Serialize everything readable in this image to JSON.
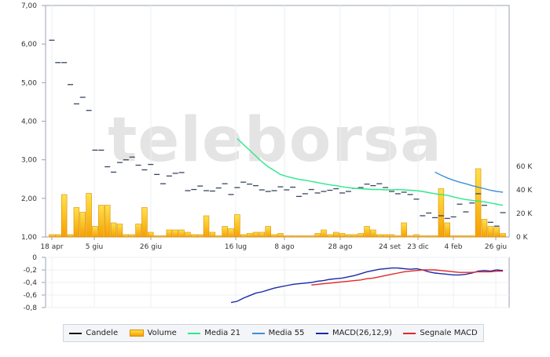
{
  "chart_data": [
    {
      "type": "candlestick",
      "panel": "price",
      "watermark": "teleborsa",
      "x_tick_labels": [
        "18 apr",
        "5 giu",
        "26 giu",
        "16 lug",
        "8 ago",
        "28 ago",
        "24 set",
        "23 dic",
        "4 feb",
        "26 giu"
      ],
      "y_left": {
        "ylim": [
          1.0,
          7.0
        ],
        "ticks": [
          "1,00",
          "2,00",
          "3,00",
          "4,00",
          "5,00",
          "6,00",
          "7,00"
        ]
      },
      "y_right": {
        "ylim": [
          0,
          60000
        ],
        "ticks": [
          "0 K",
          "20 K",
          "40 K",
          "60 K"
        ]
      },
      "grid": true,
      "series": [
        {
          "name": "Candele",
          "values": [
            6.1,
            5.52,
            5.52,
            4.95,
            4.45,
            4.62,
            4.28,
            3.25,
            3.25,
            2.82,
            2.68,
            2.93,
            3.0,
            3.07,
            2.86,
            2.74,
            2.88,
            2.62,
            2.38,
            2.58,
            2.65,
            2.67,
            2.2,
            2.23,
            2.32,
            2.2,
            2.19,
            2.27,
            2.38,
            2.1,
            2.28,
            2.42,
            2.37,
            2.33,
            2.22,
            2.18,
            2.2,
            2.3,
            2.22,
            2.29,
            2.05,
            2.12,
            2.23,
            2.14,
            2.18,
            2.21,
            2.25,
            2.14,
            2.18,
            2.26,
            2.28,
            2.37,
            2.33,
            2.38,
            2.28,
            2.18,
            2.12,
            2.16,
            2.1,
            1.98,
            1.55,
            1.62,
            1.5,
            1.55,
            1.48,
            1.52,
            1.85,
            1.65,
            1.88,
            2.12,
            1.82,
            1.38,
            1.28,
            1.63
          ]
        },
        {
          "name": "Volume",
          "values": [
            2000,
            2000,
            36000,
            2000,
            25000,
            21000,
            37000,
            9000,
            27000,
            27000,
            12000,
            11000,
            2000,
            2000,
            11000,
            25000,
            4000,
            1000,
            1000,
            6000,
            6000,
            6000,
            4000,
            2000,
            2000,
            18000,
            4000,
            1000,
            9000,
            7000,
            19000,
            2000,
            3000,
            4000,
            4000,
            9000,
            2000,
            3000,
            1000,
            1000,
            1000,
            1000,
            1000,
            3000,
            6000,
            2000,
            4000,
            3000,
            2000,
            2000,
            3000,
            9000,
            6000,
            2000,
            2000,
            2000,
            1000,
            12000,
            1000,
            2000,
            1000,
            1000,
            1000,
            41000,
            12000,
            1000,
            1000,
            1000,
            1000,
            58000,
            15000,
            9000,
            8000,
            3000
          ]
        },
        {
          "name": "Media 21",
          "values": [
            3.55,
            3.4,
            3.25,
            3.1,
            2.95,
            2.82,
            2.72,
            2.62,
            2.57,
            2.53,
            2.49,
            2.47,
            2.44,
            2.41,
            2.38,
            2.35,
            2.33,
            2.3,
            2.28,
            2.26,
            2.25,
            2.24,
            2.23,
            2.23,
            2.22,
            2.22,
            2.23,
            2.22,
            2.21,
            2.2,
            2.18,
            2.15,
            2.12,
            2.1,
            2.08,
            2.04,
            2.0,
            1.97,
            1.95,
            1.93,
            1.91,
            1.88,
            1.85,
            1.82
          ]
        },
        {
          "name": "Media 55",
          "values": [
            2.68,
            2.6,
            2.53,
            2.47,
            2.42,
            2.38,
            2.33,
            2.29,
            2.25,
            2.21,
            2.18,
            2.16
          ]
        }
      ]
    },
    {
      "type": "line",
      "panel": "macd",
      "y_left": {
        "ylim": [
          -0.8,
          0.0
        ],
        "ticks": [
          "0",
          "-0,2",
          "-0,4",
          "-0,6",
          "-0,8"
        ]
      },
      "series": [
        {
          "name": "MACD(26,12,9)",
          "values": [
            -0.72,
            -0.7,
            -0.65,
            -0.61,
            -0.57,
            -0.55,
            -0.52,
            -0.49,
            -0.47,
            -0.45,
            -0.43,
            -0.42,
            -0.41,
            -0.4,
            -0.38,
            -0.37,
            -0.35,
            -0.34,
            -0.33,
            -0.31,
            -0.29,
            -0.26,
            -0.23,
            -0.21,
            -0.19,
            -0.18,
            -0.17,
            -0.17,
            -0.18,
            -0.19,
            -0.18,
            -0.2,
            -0.23,
            -0.25,
            -0.26,
            -0.27,
            -0.28,
            -0.28,
            -0.27,
            -0.25,
            -0.22,
            -0.21,
            -0.22,
            -0.2,
            -0.21
          ]
        },
        {
          "name": "Segnale MACD",
          "values": [
            -0.44,
            -0.43,
            -0.42,
            -0.41,
            -0.4,
            -0.39,
            -0.38,
            -0.37,
            -0.36,
            -0.34,
            -0.33,
            -0.31,
            -0.29,
            -0.27,
            -0.25,
            -0.23,
            -0.22,
            -0.21,
            -0.2,
            -0.2,
            -0.2,
            -0.21,
            -0.22,
            -0.23,
            -0.24,
            -0.24,
            -0.24,
            -0.23,
            -0.23,
            -0.23,
            -0.22,
            -0.22
          ]
        }
      ]
    }
  ],
  "legend": {
    "items": [
      {
        "label": "Candele",
        "kind": "line",
        "color": "#111111"
      },
      {
        "label": "Volume",
        "kind": "bar",
        "color": "#f6a000"
      },
      {
        "label": "Media 21",
        "kind": "line",
        "color": "#2ee88c"
      },
      {
        "label": "Media 55",
        "kind": "line",
        "color": "#3f8fd8"
      },
      {
        "label": "MACD(26,12,9)",
        "kind": "line",
        "color": "#1a2aa8"
      },
      {
        "label": "Segnale MACD",
        "kind": "line",
        "color": "#e0282a"
      }
    ]
  }
}
